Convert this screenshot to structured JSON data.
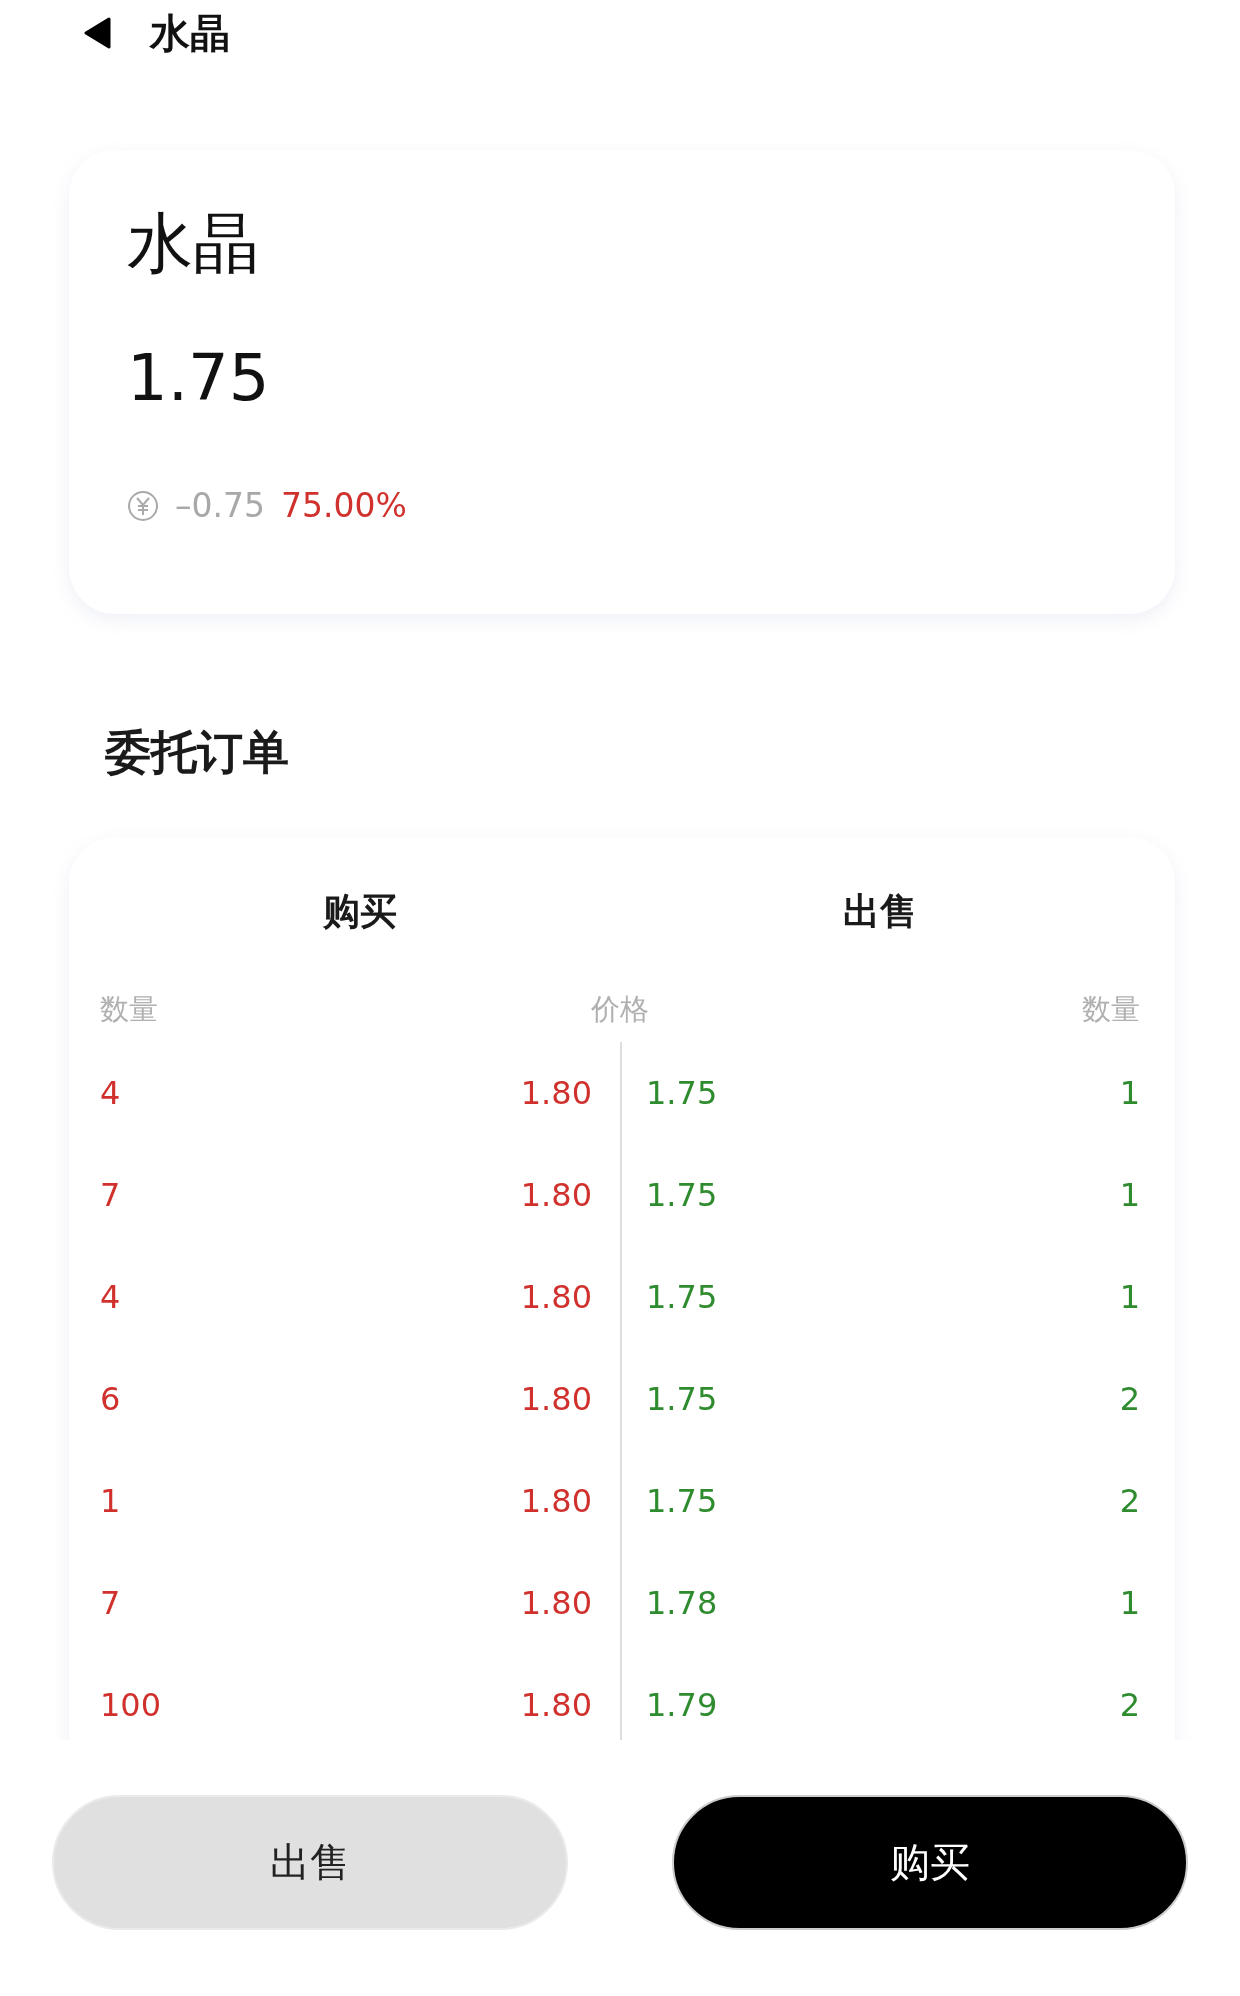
{
  "header": {
    "title": "水晶"
  },
  "quote": {
    "name": "水晶",
    "price": "1.75",
    "change": "–0.75",
    "change_percent": "75.00%"
  },
  "orders": {
    "title": "委托订单",
    "sides": [
      "购买",
      "出售"
    ],
    "columns": [
      "数量",
      "价格",
      "数量"
    ],
    "rows": [
      {
        "buy_quantity": "4",
        "buy_price": "1.80",
        "sell_price": "1.75",
        "sell_quantity": "1"
      },
      {
        "buy_quantity": "7",
        "buy_price": "1.80",
        "sell_price": "1.75",
        "sell_quantity": "1"
      },
      {
        "buy_quantity": "4",
        "buy_price": "1.80",
        "sell_price": "1.75",
        "sell_quantity": "1"
      },
      {
        "buy_quantity": "6",
        "buy_price": "1.80",
        "sell_price": "1.75",
        "sell_quantity": "2"
      },
      {
        "buy_quantity": "1",
        "buy_price": "1.80",
        "sell_price": "1.75",
        "sell_quantity": "2"
      },
      {
        "buy_quantity": "7",
        "buy_price": "1.80",
        "sell_price": "1.78",
        "sell_quantity": "1"
      },
      {
        "buy_quantity": "100",
        "buy_price": "1.80",
        "sell_price": "1.79",
        "sell_quantity": "2"
      }
    ]
  },
  "actions": [
    {
      "label": "出售",
      "kind": "secondary"
    },
    {
      "label": "购买",
      "kind": "primary"
    }
  ]
}
